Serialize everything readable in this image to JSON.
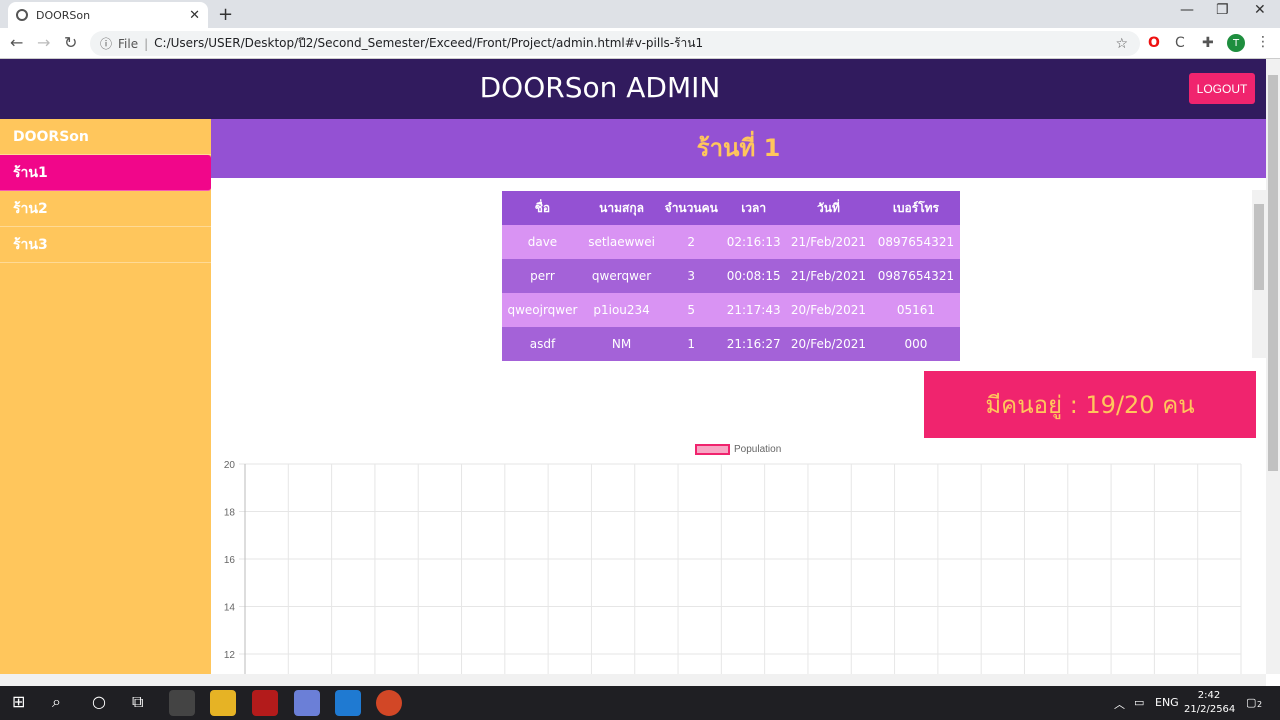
{
  "browser": {
    "tab_title": "DOORSon",
    "tab_close": "✕",
    "new_tab": "+",
    "url_file_label": "File",
    "url": "C:/Users/USER/Desktop/ปี2/Second_Semester/Exceed/Front/Project/admin.html#v-pills-ร้าน1",
    "profile_initial": "T",
    "minimize": "—",
    "maximize": "❐",
    "close": "✕"
  },
  "header": {
    "brand": "DOORSon ADMIN",
    "logout_label": "LOGOUT"
  },
  "sidebar": {
    "items": [
      {
        "label": "DOORSon"
      },
      {
        "label": "ร้าน1"
      },
      {
        "label": "ร้าน2"
      },
      {
        "label": "ร้าน3"
      }
    ]
  },
  "shop": {
    "title": "ร้านที่ 1"
  },
  "table": {
    "headers": [
      "ชื่อ",
      "นามสกุล",
      "จำนวนคน",
      "เวลา",
      "วันที่",
      "เบอร์โทร"
    ],
    "rows": [
      [
        "dave",
        "setlaewwei",
        "2",
        "02:16:13",
        "21/Feb/2021",
        "0897654321"
      ],
      [
        "perr",
        "qwerqwer",
        "3",
        "00:08:15",
        "21/Feb/2021",
        "0987654321"
      ],
      [
        "qweojrqwer",
        "p1iou234",
        "5",
        "21:17:43",
        "20/Feb/2021",
        "05161"
      ],
      [
        "asdf",
        "NM",
        "1",
        "21:16:27",
        "20/Feb/2021",
        "000"
      ]
    ]
  },
  "occupancy": {
    "text": "มีคนอยู่ :  19/20  คน"
  },
  "chart_data": {
    "type": "line",
    "series": [
      {
        "name": "Population",
        "values": []
      }
    ],
    "y_ticks": [
      "20",
      "18",
      "16",
      "14",
      "12"
    ],
    "ylim": [
      12,
      20
    ],
    "grid": true,
    "legend": "top-center",
    "colors": {
      "series": "#f0246e"
    }
  },
  "taskbar": {
    "lang": "ENG",
    "time": "2:42",
    "date": "21/2/2564",
    "notif_count": "2"
  },
  "colors": {
    "header_bg": "#311b5e",
    "sidebar_bg": "#ffc65c",
    "accent_pink": "#f0246e",
    "active_item": "#f1068a",
    "purple": "#9451d3"
  }
}
